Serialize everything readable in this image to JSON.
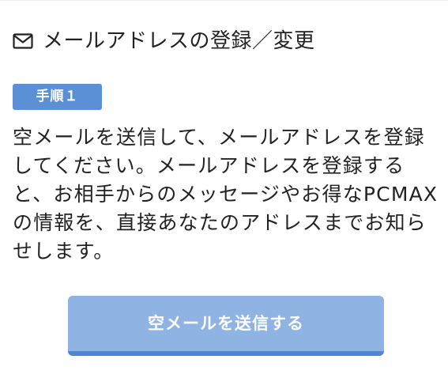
{
  "header": {
    "icon": "mail-icon",
    "title": "メールアドレスの登録／変更"
  },
  "step": {
    "label": "手順１"
  },
  "description": {
    "text": "空メールを送信して、メールアドレスを登録してください。メールアドレスを登録すると、お相手からのメッセージやお得なPCMAXの情報を、直接あなたのアドレスまでお知らせします。"
  },
  "actions": {
    "send_label": "空メールを送信する"
  },
  "colors": {
    "badge": "#5b8fd6",
    "button": "#8fb3e3",
    "button_border": "#4f86d1",
    "text": "#222222"
  }
}
